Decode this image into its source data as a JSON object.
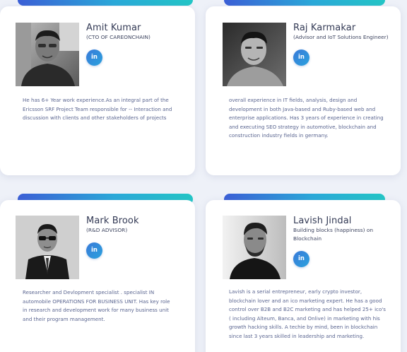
{
  "colors": {
    "page_background": "#eef1f8",
    "card_background": "#ffffff",
    "accent_gradient_start": "#3b5fd6",
    "accent_gradient_end": "#23c6c6",
    "linkedin_button": "#2f8fdb",
    "name_text": "#333a55",
    "bio_text": "#5a6590"
  },
  "team": [
    {
      "name": "Amit Kumar",
      "role": "(CTO OF CAREONCHAIN)",
      "social_label": "in",
      "social_icon": "linkedin-icon",
      "bio": "He has 6+ Year work experience.As an integral part of the Ericsson SRF Project Team responsible for -- Interaction and discussion with clients and other stakeholders of projects"
    },
    {
      "name": "Raj Karmakar",
      "role": "(Advisor and IoT Solutions Engineer)",
      "social_label": "in",
      "social_icon": "linkedin-icon",
      "bio": "overall experience in IT fields, analysis, design and development in both Java-based and Ruby-based web and enterprise applications. Has 3 years of experience in creating and executing SEO strategy in automotive, blockchain and construction industry fields in germany."
    },
    {
      "name": "Mark Brook",
      "role": "(R&D ADVISOR)",
      "social_label": "in",
      "social_icon": "linkedin-icon",
      "bio": "Researcher and Devlopment specialist . specialist IN automobile OPERATIONS FOR BUSINESS UNIT. Has key role in research and development work for many business unit and their program management."
    },
    {
      "name": "Lavish Jindal",
      "role": "Building blocks (happiness) on Blockchain",
      "social_label": "in",
      "social_icon": "linkedin-icon",
      "bio": "Lavish is a serial entrepreneur, early crypto investor, blockchain lover and an ico marketing expert. He has a good control over B2B and B2C marketing and has helped 25+ ico's ( including Alteum, Banca, and Onlive) in marketing with his growth hacking skills. A techie by mind, been in blockchain since last 3 years skilled in leadership and marketing."
    }
  ]
}
